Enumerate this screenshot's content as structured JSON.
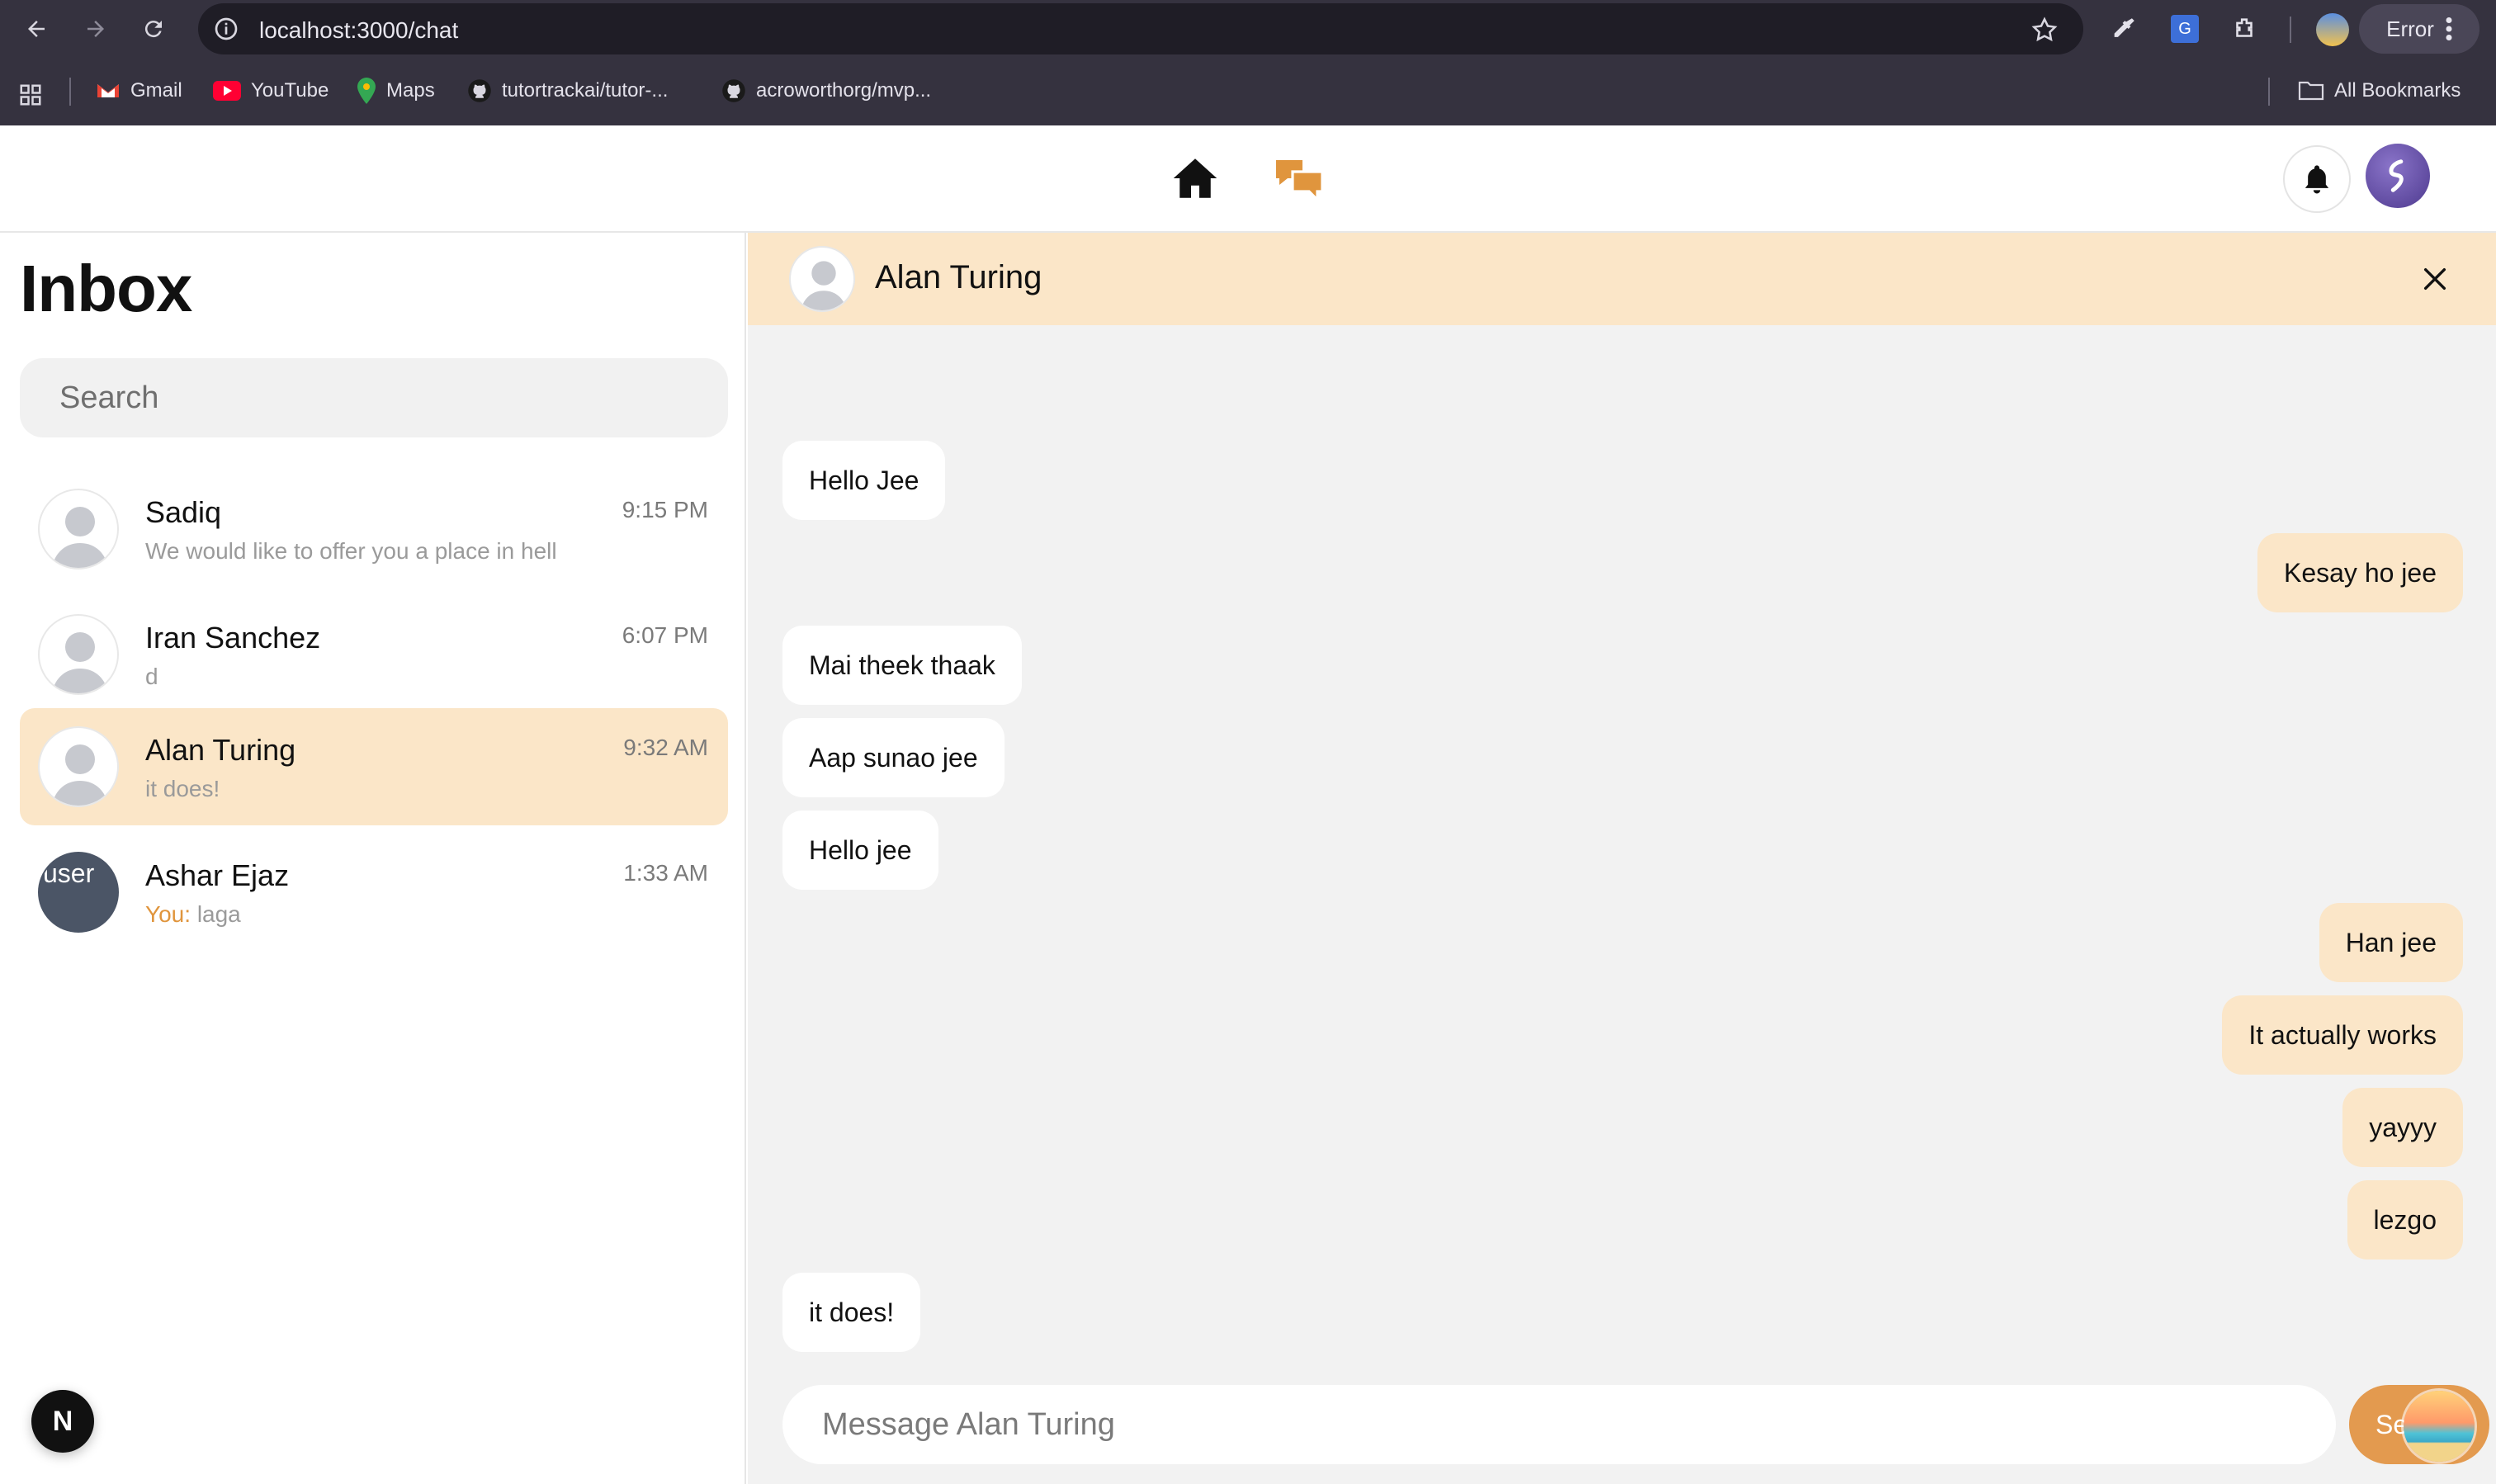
{
  "browser": {
    "url": "localhost:3000/chat",
    "error_label": "Error",
    "bookmarks": [
      {
        "label": "Gmail",
        "icon": "gmail-icon"
      },
      {
        "label": "YouTube",
        "icon": "youtube-icon"
      },
      {
        "label": "Maps",
        "icon": "maps-icon"
      },
      {
        "label": "tutortrackai/tutor-...",
        "icon": "github-icon"
      },
      {
        "label": "acroworthorg/mvp...",
        "icon": "github-icon"
      }
    ],
    "all_bookmarks": "All Bookmarks"
  },
  "header": {
    "accent": "#e0953d"
  },
  "sidebar": {
    "title": "Inbox",
    "search_placeholder": "Search",
    "conversations": [
      {
        "name": "Sadiq",
        "time": "9:15 PM",
        "preview": "We would like to offer you a place in hell",
        "you_prefix": "",
        "active": false
      },
      {
        "name": "Iran Sanchez",
        "time": "6:07 PM",
        "preview": "d",
        "you_prefix": "",
        "active": false
      },
      {
        "name": "Alan Turing",
        "time": "9:32 AM",
        "preview": "it does!",
        "you_prefix": "",
        "active": true
      },
      {
        "name": "Ashar Ejaz",
        "time": "1:33 AM",
        "preview": "laga",
        "you_prefix": "You:",
        "active": false,
        "avatar_alt": "user"
      }
    ],
    "dev_badge": "N"
  },
  "chat": {
    "contact_name": "Alan Turing",
    "messages": [
      {
        "text": "Hello Jee",
        "direction": "in"
      },
      {
        "text": "Kesay ho jee",
        "direction": "out"
      },
      {
        "text": "Mai theek thaak",
        "direction": "in"
      },
      {
        "text": "Aap sunao jee",
        "direction": "in"
      },
      {
        "text": "Hello jee",
        "direction": "in"
      },
      {
        "text": "Han jee",
        "direction": "out"
      },
      {
        "text": "It actually works",
        "direction": "out"
      },
      {
        "text": "yayyy",
        "direction": "out"
      },
      {
        "text": "lezgo",
        "direction": "out"
      },
      {
        "text": "it does!",
        "direction": "in"
      }
    ],
    "composer_placeholder": "Message Alan Turing",
    "send_label": "Se"
  }
}
